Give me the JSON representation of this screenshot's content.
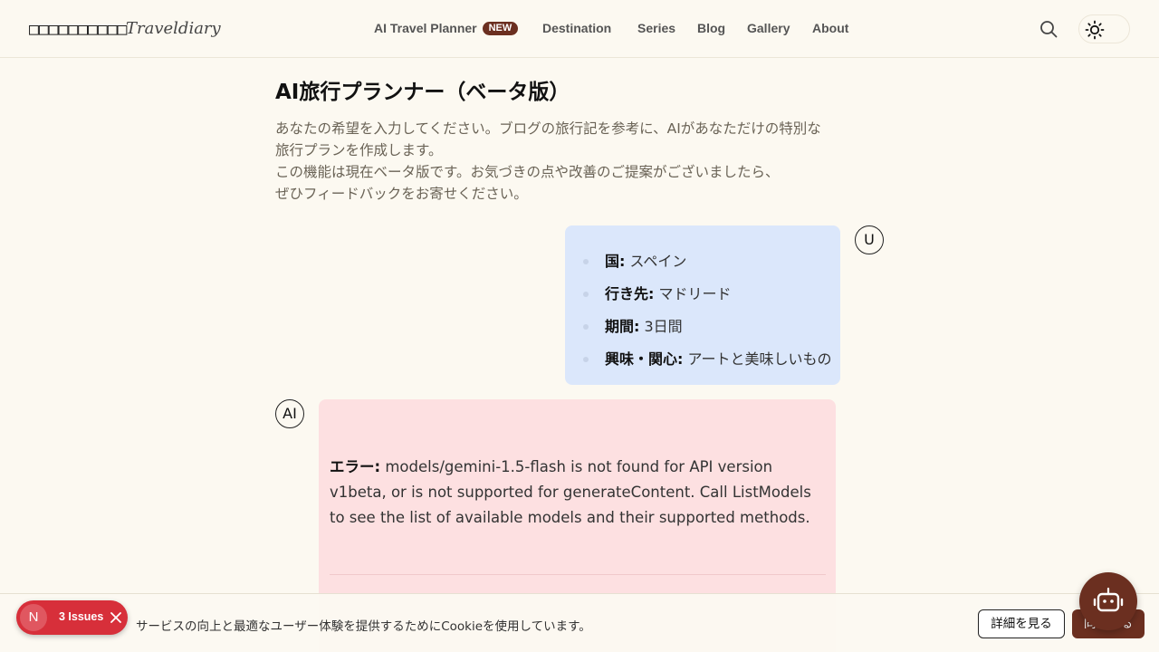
{
  "header": {
    "logo_boxes": "□□□□□□□□□□",
    "logo_script": "Traveldiary",
    "nav": [
      {
        "label": "AI Travel Planner",
        "badge": "NEW"
      },
      {
        "label": "Destination"
      },
      {
        "label": "Series"
      },
      {
        "label": "Blog"
      },
      {
        "label": "Gallery"
      },
      {
        "label": "About"
      }
    ],
    "icons": {
      "search": "search-icon",
      "theme": "sun-icon"
    }
  },
  "main": {
    "title": "AI旅行プランナー（ベータ版）",
    "intro_lines": [
      "あなたの希望を入力してください。ブログの旅行記を参考に、AIがあなただけの特別な",
      "旅行プランを作成します。",
      "この機能は現在ベータ版です。お気づきの点や改善のご提案がございましたら、",
      "ぜひフィードバックをお寄せください。"
    ]
  },
  "chat": {
    "user_avatar": "U",
    "user_items": [
      {
        "key": "国:",
        "value": " スペイン"
      },
      {
        "key": "行き先:",
        "value": " マドリード"
      },
      {
        "key": "期間:",
        "value": " 3日間"
      },
      {
        "key": "興味・関心:",
        "value": " アートと美味しいもの"
      }
    ],
    "ai_avatar": "AI",
    "ai_error_label": "エラー:",
    "ai_error_text": " models/gemini-1.5-flash is not found for API version v1beta, or is not supported for generateContent. Call ListModels to see the list of available models and their supported methods."
  },
  "cookie": {
    "text": "サービスの向上と最適なユーザー体験を提供するためにCookieを使用しています。",
    "details_label": "詳細を見る",
    "accept_label": "同意する"
  },
  "issues": {
    "logo": "N",
    "label": "3 Issues"
  },
  "colors": {
    "background": "#fcf9f1",
    "accent": "#6b2f20",
    "user_bubble": "#dbe7fb",
    "ai_bubble": "#fde0e1",
    "issues": "#d72f3a"
  }
}
